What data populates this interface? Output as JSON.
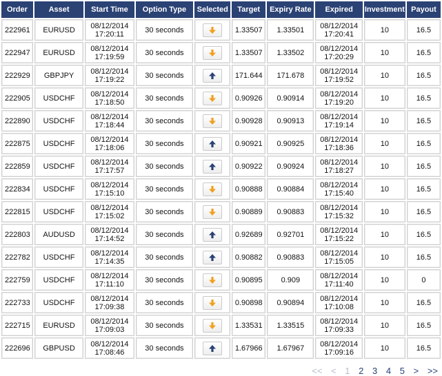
{
  "columns": {
    "order": "Order",
    "asset": "Asset",
    "start_time": "Start Time",
    "option_type": "Option Type",
    "selected": "Selected",
    "target": "Target",
    "expiry_rate": "Expiry Rate",
    "expired": "Expired",
    "investment": "Investment",
    "payout": "Payout"
  },
  "colors": {
    "header_bg": "#2b4275",
    "down_arrow": "#f0a020",
    "up_arrow": "#2b4275"
  },
  "rows": [
    {
      "order": "222961",
      "asset": "EURUSD",
      "start_date": "08/12/2014",
      "start_clock": "17:20:11",
      "option_type": "30 seconds",
      "direction": "down",
      "target": "1.33507",
      "expiry_rate": "1.33501",
      "expired_date": "08/12/2014",
      "expired_clock": "17:20:41",
      "investment": "10",
      "payout": "16.5"
    },
    {
      "order": "222947",
      "asset": "EURUSD",
      "start_date": "08/12/2014",
      "start_clock": "17:19:59",
      "option_type": "30 seconds",
      "direction": "down",
      "target": "1.33507",
      "expiry_rate": "1.33502",
      "expired_date": "08/12/2014",
      "expired_clock": "17:20:29",
      "investment": "10",
      "payout": "16.5"
    },
    {
      "order": "222929",
      "asset": "GBPJPY",
      "start_date": "08/12/2014",
      "start_clock": "17:19:22",
      "option_type": "30 seconds",
      "direction": "up",
      "target": "171.644",
      "expiry_rate": "171.678",
      "expired_date": "08/12/2014",
      "expired_clock": "17:19:52",
      "investment": "10",
      "payout": "16.5"
    },
    {
      "order": "222905",
      "asset": "USDCHF",
      "start_date": "08/12/2014",
      "start_clock": "17:18:50",
      "option_type": "30 seconds",
      "direction": "down",
      "target": "0.90926",
      "expiry_rate": "0.90914",
      "expired_date": "08/12/2014",
      "expired_clock": "17:19:20",
      "investment": "10",
      "payout": "16.5"
    },
    {
      "order": "222890",
      "asset": "USDCHF",
      "start_date": "08/12/2014",
      "start_clock": "17:18:44",
      "option_type": "30 seconds",
      "direction": "down",
      "target": "0.90928",
      "expiry_rate": "0.90913",
      "expired_date": "08/12/2014",
      "expired_clock": "17:19:14",
      "investment": "10",
      "payout": "16.5"
    },
    {
      "order": "222875",
      "asset": "USDCHF",
      "start_date": "08/12/2014",
      "start_clock": "17:18:06",
      "option_type": "30 seconds",
      "direction": "up",
      "target": "0.90921",
      "expiry_rate": "0.90925",
      "expired_date": "08/12/2014",
      "expired_clock": "17:18:36",
      "investment": "10",
      "payout": "16.5"
    },
    {
      "order": "222859",
      "asset": "USDCHF",
      "start_date": "08/12/2014",
      "start_clock": "17:17:57",
      "option_type": "30 seconds",
      "direction": "up",
      "target": "0.90922",
      "expiry_rate": "0.90924",
      "expired_date": "08/12/2014",
      "expired_clock": "17:18:27",
      "investment": "10",
      "payout": "16.5"
    },
    {
      "order": "222834",
      "asset": "USDCHF",
      "start_date": "08/12/2014",
      "start_clock": "17:15:10",
      "option_type": "30 seconds",
      "direction": "down",
      "target": "0.90888",
      "expiry_rate": "0.90884",
      "expired_date": "08/12/2014",
      "expired_clock": "17:15:40",
      "investment": "10",
      "payout": "16.5"
    },
    {
      "order": "222815",
      "asset": "USDCHF",
      "start_date": "08/12/2014",
      "start_clock": "17:15:02",
      "option_type": "30 seconds",
      "direction": "down",
      "target": "0.90889",
      "expiry_rate": "0.90883",
      "expired_date": "08/12/2014",
      "expired_clock": "17:15:32",
      "investment": "10",
      "payout": "16.5"
    },
    {
      "order": "222803",
      "asset": "AUDUSD",
      "start_date": "08/12/2014",
      "start_clock": "17:14:52",
      "option_type": "30 seconds",
      "direction": "up",
      "target": "0.92689",
      "expiry_rate": "0.92701",
      "expired_date": "08/12/2014",
      "expired_clock": "17:15:22",
      "investment": "10",
      "payout": "16.5"
    },
    {
      "order": "222782",
      "asset": "USDCHF",
      "start_date": "08/12/2014",
      "start_clock": "17:14:35",
      "option_type": "30 seconds",
      "direction": "up",
      "target": "0.90882",
      "expiry_rate": "0.90883",
      "expired_date": "08/12/2014",
      "expired_clock": "17:15:05",
      "investment": "10",
      "payout": "16.5"
    },
    {
      "order": "222759",
      "asset": "USDCHF",
      "start_date": "08/12/2014",
      "start_clock": "17:11:10",
      "option_type": "30 seconds",
      "direction": "down",
      "target": "0.90895",
      "expiry_rate": "0.909",
      "expired_date": "08/12/2014",
      "expired_clock": "17:11:40",
      "investment": "10",
      "payout": "0"
    },
    {
      "order": "222733",
      "asset": "USDCHF",
      "start_date": "08/12/2014",
      "start_clock": "17:09:38",
      "option_type": "30 seconds",
      "direction": "down",
      "target": "0.90898",
      "expiry_rate": "0.90894",
      "expired_date": "08/12/2014",
      "expired_clock": "17:10:08",
      "investment": "10",
      "payout": "16.5"
    },
    {
      "order": "222715",
      "asset": "EURUSD",
      "start_date": "08/12/2014",
      "start_clock": "17:09:03",
      "option_type": "30 seconds",
      "direction": "down",
      "target": "1.33531",
      "expiry_rate": "1.33515",
      "expired_date": "08/12/2014",
      "expired_clock": "17:09:33",
      "investment": "10",
      "payout": "16.5"
    },
    {
      "order": "222696",
      "asset": "GBPUSD",
      "start_date": "08/12/2014",
      "start_clock": "17:08:46",
      "option_type": "30 seconds",
      "direction": "up",
      "target": "1.67966",
      "expiry_rate": "1.67967",
      "expired_date": "08/12/2014",
      "expired_clock": "17:09:16",
      "investment": "10",
      "payout": "16.5"
    }
  ],
  "pagination": {
    "first": "<<",
    "prev": "<",
    "pages": [
      "1",
      "2",
      "3",
      "4",
      "5"
    ],
    "current": "1",
    "next": ">",
    "last": ">>"
  }
}
